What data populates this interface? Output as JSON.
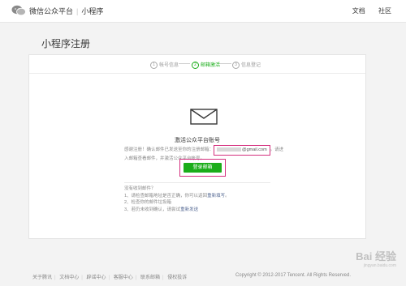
{
  "header": {
    "brand": "微信公众平台",
    "section": "小程序",
    "links": [
      "文档",
      "社区"
    ]
  },
  "page_title": "小程序注册",
  "steps": [
    {
      "num": "1",
      "label": "帐号信息"
    },
    {
      "num": "2",
      "label": "邮箱激活"
    },
    {
      "num": "3",
      "label": "信息登记"
    }
  ],
  "activation": {
    "heading": "激活公众平台账号",
    "desc_before": "感谢注册！确认邮件已发送至你的注册邮箱：",
    "email": "@gmail.com",
    "desc_after": "。请进入邮箱查看邮件，并激活公众平台帐号。",
    "button": "登录邮箱"
  },
  "help": {
    "title": "没有收到邮件？",
    "item1_before": "1、请检查邮箱地址是否正确，你可以返回",
    "item1_link": "重新填写",
    "item1_after": "。",
    "item2": "2、检查你的邮件垃圾箱",
    "item3_before": "3、若仍未收到确认，请尝试",
    "item3_link": "重新发送"
  },
  "footer": {
    "links": [
      "关于腾讯",
      "文档中心",
      "辟谣中心",
      "客服中心",
      "联系邮箱",
      "侵权投诉"
    ],
    "copyright": "Copyright © 2012-2017 Tencent. All Rights Reserved."
  },
  "watermark": {
    "text": "Bai 经验",
    "sub": "jingyan.baidu.com"
  }
}
